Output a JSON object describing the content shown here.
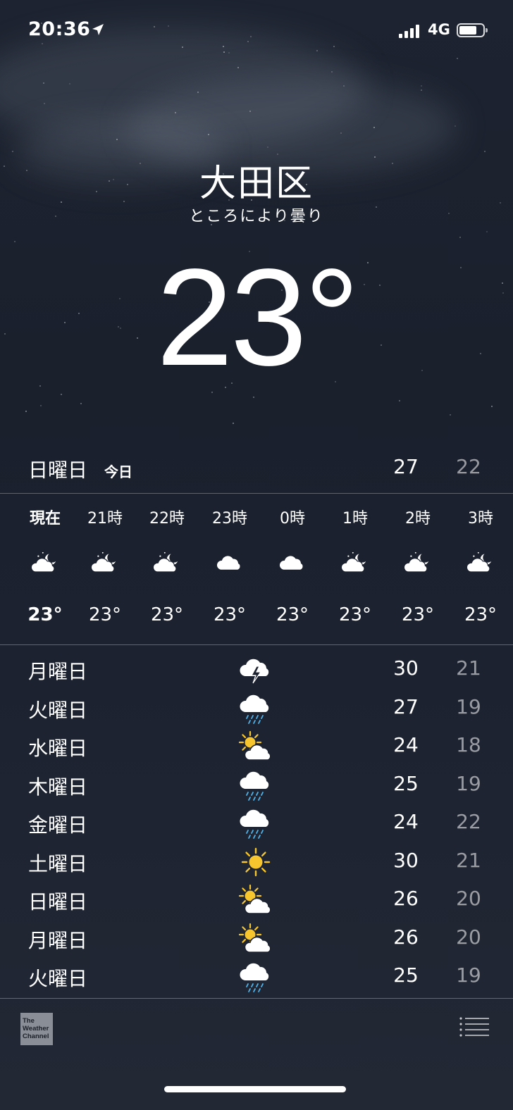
{
  "status_bar": {
    "time": "20:36",
    "network": "4G",
    "signal_bars": 4,
    "battery_level": 0.75
  },
  "location": {
    "city": "大田区",
    "condition": "ところにより曇り",
    "temperature": "23°"
  },
  "today": {
    "day": "日曜日",
    "tag": "今日",
    "high": "27",
    "low": "22"
  },
  "hourly": [
    {
      "label": "現在",
      "icon": "night-partly-cloudy-icon",
      "temp": "23°",
      "current": true
    },
    {
      "label": "21時",
      "icon": "night-partly-cloudy-icon",
      "temp": "23°"
    },
    {
      "label": "22時",
      "icon": "night-partly-cloudy-icon",
      "temp": "23°"
    },
    {
      "label": "23時",
      "icon": "cloud-icon",
      "temp": "23°"
    },
    {
      "label": "0時",
      "icon": "cloud-icon",
      "temp": "23°"
    },
    {
      "label": "1時",
      "icon": "night-partly-cloudy-icon",
      "temp": "23°"
    },
    {
      "label": "2時",
      "icon": "night-partly-cloudy-icon",
      "temp": "23°"
    },
    {
      "label": "3時",
      "icon": "night-partly-cloudy-icon",
      "temp": "23°"
    }
  ],
  "daily": [
    {
      "day": "月曜日",
      "icon": "thunderstorm-icon",
      "high": "30",
      "low": "21"
    },
    {
      "day": "火曜日",
      "icon": "rain-icon",
      "high": "27",
      "low": "19"
    },
    {
      "day": "水曜日",
      "icon": "partly-sunny-icon",
      "high": "24",
      "low": "18"
    },
    {
      "day": "木曜日",
      "icon": "rain-icon",
      "high": "25",
      "low": "19"
    },
    {
      "day": "金曜日",
      "icon": "rain-icon",
      "high": "24",
      "low": "22"
    },
    {
      "day": "土曜日",
      "icon": "sun-icon",
      "high": "30",
      "low": "21"
    },
    {
      "day": "日曜日",
      "icon": "partly-sunny-icon",
      "high": "26",
      "low": "20"
    },
    {
      "day": "月曜日",
      "icon": "partly-sunny-icon",
      "high": "26",
      "low": "20"
    },
    {
      "day": "火曜日",
      "icon": "rain-icon",
      "high": "25",
      "low": "19"
    }
  ],
  "footer": {
    "logo_lines": [
      "The",
      "Weather",
      "Channel"
    ],
    "list_icon": "list-icon"
  },
  "colors": {
    "sun": "#f7c62f",
    "rain": "#4fb3ea",
    "low_temp": "#8f949c"
  }
}
